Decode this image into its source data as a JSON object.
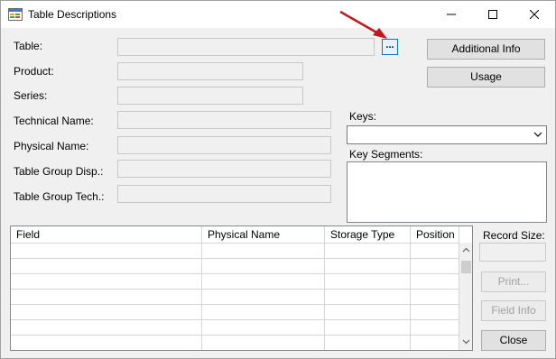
{
  "window": {
    "title": "Table Descriptions"
  },
  "labels": {
    "table": "Table:",
    "product": "Product:",
    "series": "Series:",
    "technical_name": "Technical Name:",
    "physical_name": "Physical Name:",
    "table_group_disp": "Table Group Disp.:",
    "table_group_tech": "Table Group Tech.:",
    "keys": "Keys:",
    "key_segments": "Key Segments:",
    "record_size": "Record Size:"
  },
  "buttons": {
    "browse": "...",
    "additional_info": "Additional Info",
    "usage": "Usage",
    "print": "Print...",
    "field_info": "Field Info",
    "close": "Close"
  },
  "grid": {
    "columns": [
      "Field",
      "Physical Name",
      "Storage Type",
      "Position"
    ]
  },
  "icons": {
    "app": "table-descriptions-app-icon",
    "arrow": "red-annotation-arrow"
  },
  "colors": {
    "annotation_arrow": "#c0181b",
    "focus_border": "#0078d7"
  }
}
